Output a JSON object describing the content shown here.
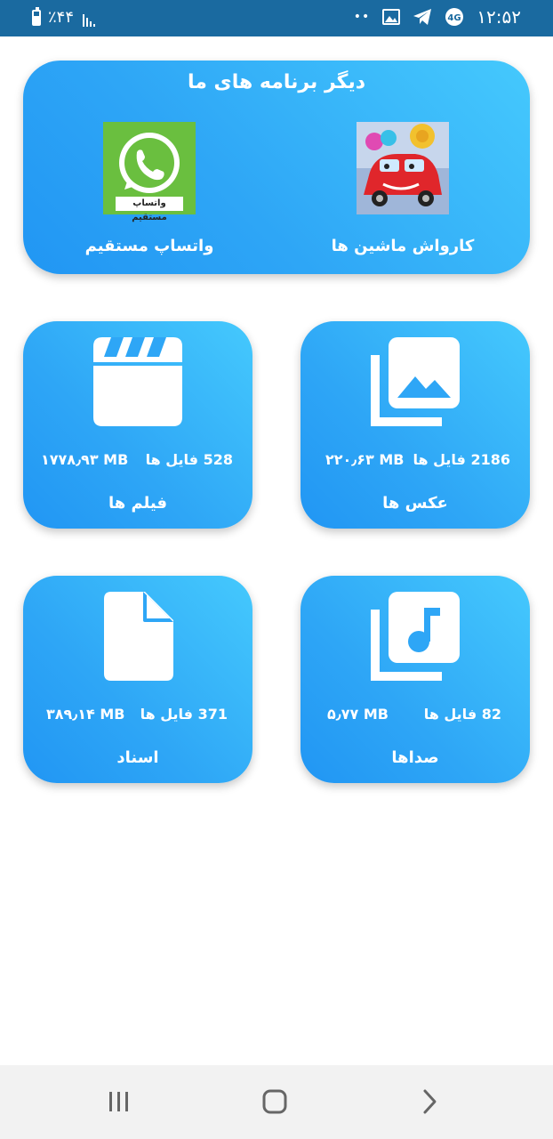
{
  "status_bar": {
    "time": "۱۲:۵۲",
    "battery": "٪۴۴",
    "dots": "••",
    "icons": [
      "battery-icon",
      "signal-icon",
      "image-notification-icon",
      "telegram-icon",
      "vpn-icon"
    ]
  },
  "other_apps": {
    "title": "دیگر برنامه های ما",
    "apps": [
      {
        "label": "کارواش ماشین ها",
        "icon": "car-wash-app-icon"
      },
      {
        "label": "واتساپ مستقیم",
        "icon": "whatsapp-direct-app-icon",
        "icon_caption": "واتساپ مستقیم"
      }
    ]
  },
  "categories": [
    {
      "label": "عکس ها",
      "count": "2186 فایل ها",
      "size": "۲۲۰٫۶۳ MB",
      "icon": "photos-icon"
    },
    {
      "label": "فیلم ها",
      "count": "528 فایل ها",
      "size": "۱۷۷۸٫۹۳ MB",
      "icon": "clapperboard-icon"
    },
    {
      "label": "صداها",
      "count": "82 فایل ها",
      "size": "۵٫۷۷ MB",
      "icon": "music-note-icon"
    },
    {
      "label": "اسناد",
      "count": "371 فایل ها",
      "size": "۳۸۹٫۱۴ MB",
      "icon": "document-icon"
    }
  ],
  "colors": {
    "status_bar": "#1a6aa0",
    "card_gradient_start": "#2196f3",
    "card_gradient_end": "#45c9fd",
    "nav_bar": "#f2f2f2"
  },
  "nav_bar": {
    "buttons": [
      "recent-apps-icon",
      "home-icon",
      "back-icon"
    ]
  }
}
